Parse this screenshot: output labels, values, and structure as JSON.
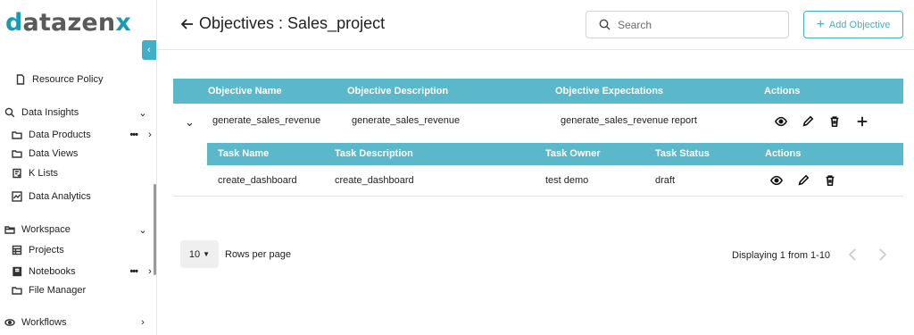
{
  "app": {
    "logo_parts": [
      "d",
      "atazen",
      "x"
    ]
  },
  "sidebar": {
    "items": [
      {
        "label": "Resource Policy",
        "icon": "file-icon"
      },
      {
        "label": "Data Insights",
        "icon": "search-insights-icon"
      },
      {
        "label": "Data Products",
        "icon": "folder-icon"
      },
      {
        "label": "Data Views",
        "icon": "folder-icon"
      },
      {
        "label": "K Lists",
        "icon": "list-check-icon"
      },
      {
        "label": "Data Analytics",
        "icon": "chart-line-icon"
      },
      {
        "label": "Workspace",
        "icon": "folder-open-icon"
      },
      {
        "label": "Projects",
        "icon": "grid-icon"
      },
      {
        "label": "Notebooks",
        "icon": "notebook-icon"
      },
      {
        "label": "File Manager",
        "icon": "folder-icon"
      },
      {
        "label": "Workflows",
        "icon": "workflow-icon"
      }
    ],
    "more_label": "•••"
  },
  "header": {
    "title": "Objectives : Sales_project",
    "search_placeholder": "Search",
    "add_button_label": "Add Objective"
  },
  "objectives_table": {
    "columns": [
      "Objective Name",
      "Objective Description",
      "Objective Expectations",
      "Actions"
    ],
    "rows": [
      {
        "name": "generate_sales_revenue",
        "description": "generate_sales_revenue",
        "expectations": "generate_sales_revenue report"
      }
    ]
  },
  "tasks_table": {
    "columns": [
      "Task Name",
      "Task Description",
      "Task Owner",
      "Task Status",
      "Actions"
    ],
    "rows": [
      {
        "name": "create_dashboard",
        "description": "create_dashboard",
        "owner": "test demo",
        "status": "draft"
      }
    ]
  },
  "pagination": {
    "rows_per_page_value": "10",
    "rows_per_page_label": "Rows per page",
    "displaying": "Displaying 1 from 1-10"
  },
  "colors": {
    "accent": "#43b1c7",
    "table_header": "#5bb8ca"
  }
}
